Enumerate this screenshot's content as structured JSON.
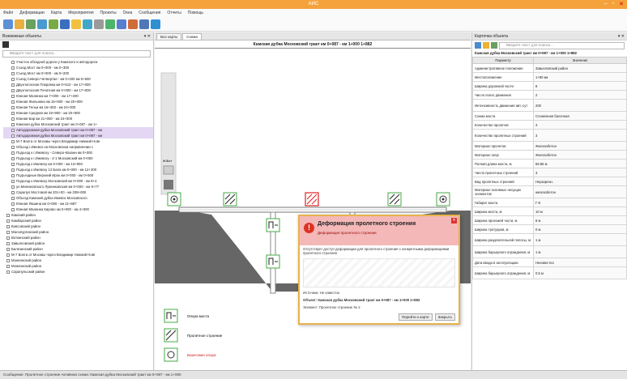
{
  "window": {
    "title": "АИС"
  },
  "menu": [
    "Файл",
    "Деформации",
    "Карта",
    "Мероприятия",
    "Проекты",
    "Окна",
    "Сообщения",
    "Отчеты",
    "Помощь"
  ],
  "left_panel": {
    "title": "Возможные объекты",
    "search_placeholder": "Введите текст для поиска...",
    "items": [
      "Участок обходной дороги у Камского и автодороги",
      "Съезд Мост км 0+000 - км 0+300",
      "Съезд Мост км 0+000 - км 0+200",
      "Съезд Северо-Четвертая - км 0+200 км 0+600",
      "Двухполосная Покровка км 0+510 - км 17+000",
      "Двухполосная Печатная км 0+000 - км 17+000",
      "Южная Малинка км 7+000 - км 17+200",
      "Южная Жильника км 16+000 - км 25+000",
      "Южная Тельи км 16+300 - км 24+000",
      "Южная Средная км 19+900 - км 20+900",
      "Южная Бар км 21+000 - км 24+000",
      "Камская дубка Московский тракт км 0+087 - км 1+",
      "Автодорожная дубка Московский тракт км 0+087 - км",
      "Автодорожная дубка Московский тракт км 0+087 - км",
      "М-7 Волга от Москвы через Владимир Нижний Новг",
      "Объезд г.Ижевск на Московском направлении с",
      "Подъезд к г.Ижевску - Северо-Казани км 0+000",
      "Подъезд к г.Ижевску - 2-1 Московский км 0+000",
      "Подъезд к Ижевску км 0+000 - км 13+900",
      "Подъезд к Ижевску 12 Бала км 0+000 - км 12+300",
      "Подъездные Верхний Ирок км 0+000 - км 0+500",
      "Подъезд к Ижевску Московский км 0+000 - км 8+4",
      "ул.Малиновского Лужниковская км 0+000 - км 9+77",
      "Сарапул Мостовой км 201+00 - км 208+000",
      "Объезд Камский дубка Ижевск Московского",
      "Южная Якшина км 0+000 - км 21+687",
      "Южная Малинка Кирово км 0+000 - км 4+000",
      "Камский район",
      "Камбарский район",
      "Киясовский район",
      "Малопургинский район",
      "Воткинский район",
      "Завьяловский район",
      "Балезинский район",
      "М-7 Волга от Москвы через Владимир Нижний Новг",
      "Можгинский район",
      "Можгинский район",
      "Сарапульский район"
    ]
  },
  "tabs": [
    "Все карты",
    "Схема"
  ],
  "drawing": {
    "title": "Камская дубка Московский тракт км 0+087 - км 1+000 1+882",
    "side_labels": [
      "Ж/Бет",
      "СС",
      "ГП"
    ],
    "legend": [
      {
        "icon": "bridge-support-icon",
        "label": "Опора моста"
      },
      {
        "icon": "span-icon",
        "label": "Пролетное строение"
      },
      {
        "icon": "abutment-icon",
        "label": "Береговая опора"
      }
    ]
  },
  "dialog": {
    "title": "Деформация пролетного строения",
    "subtitle": "Деформация пролетного строения",
    "body": "Отсутствует доступ деформации для пролетного строения с конкретными деформациями пролетного строения",
    "status_line": "Источник: Не известно",
    "object_line": "Объект: Камская дубка Московский тракт км 0+087 - км 1+000 1+882",
    "element_line": "Элемент: Пролетное строение № 2",
    "btn_primary": "Перейти к карте",
    "btn_close": "Закрыть"
  },
  "right_panel": {
    "title": "Карточка объекта",
    "search_placeholder": "Введите текст для поиска...",
    "object_header": "Камская дубка Московский тракт км 0+087 - км 1+000 1+882",
    "col_param": "Параметр",
    "col_value": "Значение",
    "rows": [
      {
        "p": "Административное положение",
        "v": "Завьяловский район"
      },
      {
        "p": "Местоположение",
        "v": "1+80 км"
      },
      {
        "p": "Ширина дорожной части",
        "v": "8"
      },
      {
        "p": "Число полос движения",
        "v": "2"
      },
      {
        "p": "Интенсивность движения авт.-сут",
        "v": "200"
      },
      {
        "p": "Схема моста",
        "v": "Сложенная балочная"
      },
      {
        "p": "Количество пролетов",
        "v": "3"
      },
      {
        "p": "Количество пролетных строений",
        "v": "3"
      },
      {
        "p": "Материал пролетов",
        "v": "Железобетон"
      },
      {
        "p": "Материал опор",
        "v": "Железобетон"
      },
      {
        "p": "Полная длина моста, м",
        "v": "56.86 м"
      },
      {
        "p": "Число пролетных строений",
        "v": "3"
      },
      {
        "p": "Вид пролетных строений",
        "v": "Неразрезн."
      },
      {
        "p": "Материал основных несущих элементов",
        "v": "железобетон"
      },
      {
        "p": "Габарит моста",
        "v": "Г-8"
      },
      {
        "p": "Ширина моста, м",
        "v": "10 м"
      },
      {
        "p": "Ширина проезжей части, м",
        "v": "8 м"
      },
      {
        "p": "Ширина тротуаров, м",
        "v": "0 м"
      },
      {
        "p": "Ширина разделительной полосы, м",
        "v": "1 м"
      },
      {
        "p": "Ширина барьерного ограждения, м",
        "v": "1 м"
      },
      {
        "p": "Дата ввода в эксплуатацию",
        "v": "Неизвестно"
      },
      {
        "p": "Ширина барьерного ограждения, м",
        "v": "0.5 м"
      }
    ]
  },
  "status_bar": "Сообщение: Пролетное строение  Активная схема: Камская дубка Московский тракт км 0+087 - км 1+000"
}
